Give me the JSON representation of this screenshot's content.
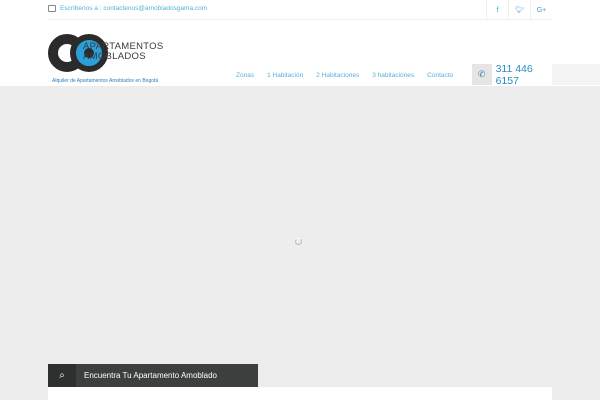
{
  "topbar": {
    "email": "Escríbenos a : contactenos@amobladosgama.com",
    "social": [
      "f",
      "t",
      "G+"
    ]
  },
  "logo": {
    "brand_line1": "APARTAMENTOS",
    "brand_line2": "AMOBLADOS",
    "tagline": "Alquiler de Apartamentos Amoblados en Bogotá"
  },
  "nav": {
    "items": [
      "Zonas",
      "1 Habitación",
      "2 Habitaciones",
      "3 habitaciones",
      "Contacto"
    ],
    "phone": "311 446 6157"
  },
  "search": {
    "label": "Encuentra Tu Apartamento Amoblado"
  }
}
